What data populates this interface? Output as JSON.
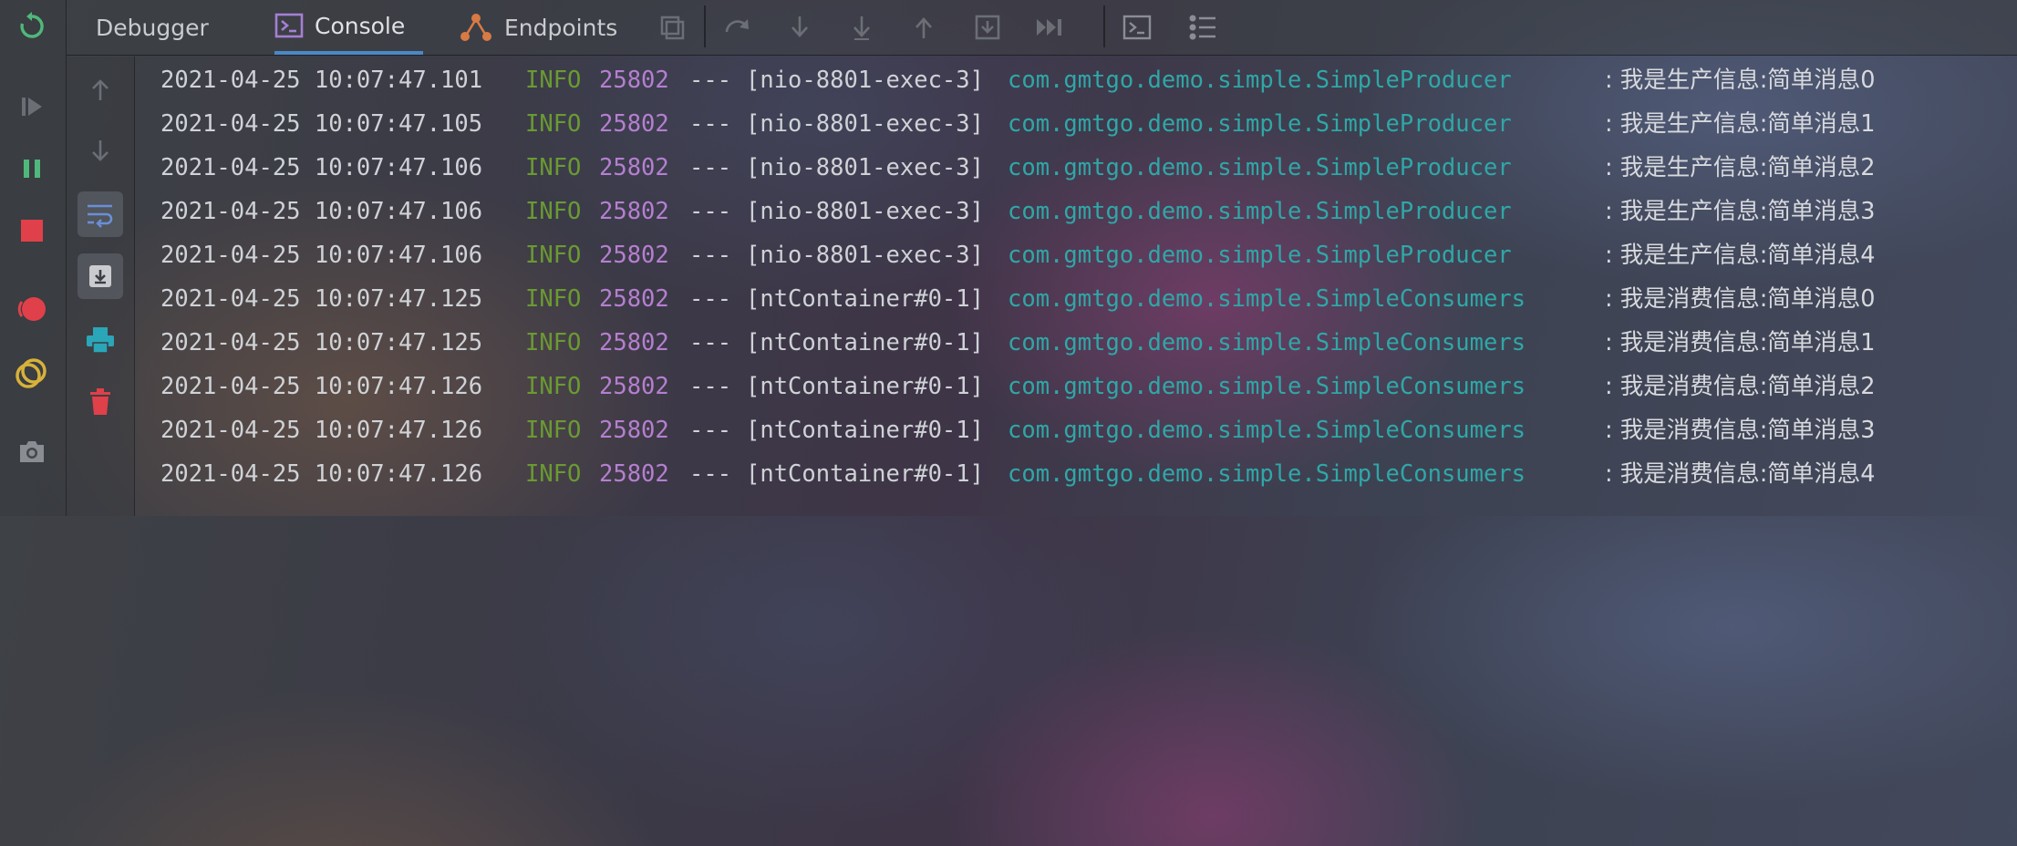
{
  "tabs": [
    {
      "label": "Debugger",
      "icon": "debugger-icon",
      "active": false
    },
    {
      "label": "Console",
      "icon": "console-icon",
      "active": true
    },
    {
      "label": "Endpoints",
      "icon": "endpoints-icon",
      "active": false
    }
  ],
  "toolbar_icons": [
    "evaluate-icon",
    "step-over-icon",
    "step-into-icon",
    "force-step-into-icon",
    "step-out-icon",
    "drop-frame-icon",
    "run-to-cursor-icon",
    "terminal-icon",
    "settings-list-icon"
  ],
  "left_tools": [
    "rerun-icon",
    "resume-icon",
    "pause-icon",
    "stop-icon",
    "view-breakpoints-icon",
    "mute-breakpoints-icon",
    "camera-icon"
  ],
  "console_tools": [
    "scroll-up-icon",
    "scroll-down-icon",
    "soft-wrap-icon",
    "scroll-to-end-icon",
    "print-icon",
    "trash-icon"
  ],
  "colors": {
    "accent": "#4a88c7",
    "info_level": "#6a9a32",
    "pid": "#b57fd0",
    "logger": "#2fa7a7",
    "stop": "#e0404a",
    "trash": "#e0404a"
  },
  "log_lines": [
    {
      "ts": "2021-04-25 10:07:47.101",
      "level": "INFO",
      "pid": "25802",
      "dash": "---",
      "thread": "[nio-8801-exec-3]",
      "logger": "com.gmtgo.demo.simple.SimpleProducer",
      "msg": ": 我是生产信息:简单消息0"
    },
    {
      "ts": "2021-04-25 10:07:47.105",
      "level": "INFO",
      "pid": "25802",
      "dash": "---",
      "thread": "[nio-8801-exec-3]",
      "logger": "com.gmtgo.demo.simple.SimpleProducer",
      "msg": ": 我是生产信息:简单消息1"
    },
    {
      "ts": "2021-04-25 10:07:47.106",
      "level": "INFO",
      "pid": "25802",
      "dash": "---",
      "thread": "[nio-8801-exec-3]",
      "logger": "com.gmtgo.demo.simple.SimpleProducer",
      "msg": ": 我是生产信息:简单消息2"
    },
    {
      "ts": "2021-04-25 10:07:47.106",
      "level": "INFO",
      "pid": "25802",
      "dash": "---",
      "thread": "[nio-8801-exec-3]",
      "logger": "com.gmtgo.demo.simple.SimpleProducer",
      "msg": ": 我是生产信息:简单消息3"
    },
    {
      "ts": "2021-04-25 10:07:47.106",
      "level": "INFO",
      "pid": "25802",
      "dash": "---",
      "thread": "[nio-8801-exec-3]",
      "logger": "com.gmtgo.demo.simple.SimpleProducer",
      "msg": ": 我是生产信息:简单消息4"
    },
    {
      "ts": "2021-04-25 10:07:47.125",
      "level": "INFO",
      "pid": "25802",
      "dash": "---",
      "thread": "[ntContainer#0-1]",
      "logger": "com.gmtgo.demo.simple.SimpleConsumers",
      "msg": ": 我是消费信息:简单消息0"
    },
    {
      "ts": "2021-04-25 10:07:47.125",
      "level": "INFO",
      "pid": "25802",
      "dash": "---",
      "thread": "[ntContainer#0-1]",
      "logger": "com.gmtgo.demo.simple.SimpleConsumers",
      "msg": ": 我是消费信息:简单消息1"
    },
    {
      "ts": "2021-04-25 10:07:47.126",
      "level": "INFO",
      "pid": "25802",
      "dash": "---",
      "thread": "[ntContainer#0-1]",
      "logger": "com.gmtgo.demo.simple.SimpleConsumers",
      "msg": ": 我是消费信息:简单消息2"
    },
    {
      "ts": "2021-04-25 10:07:47.126",
      "level": "INFO",
      "pid": "25802",
      "dash": "---",
      "thread": "[ntContainer#0-1]",
      "logger": "com.gmtgo.demo.simple.SimpleConsumers",
      "msg": ": 我是消费信息:简单消息3"
    },
    {
      "ts": "2021-04-25 10:07:47.126",
      "level": "INFO",
      "pid": "25802",
      "dash": "---",
      "thread": "[ntContainer#0-1]",
      "logger": "com.gmtgo.demo.simple.SimpleConsumers",
      "msg": ": 我是消费信息:简单消息4"
    }
  ]
}
